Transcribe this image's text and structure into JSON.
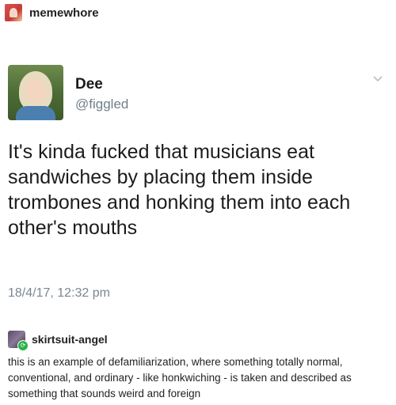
{
  "op": {
    "username": "memewhore",
    "avatar_icon": "user-avatar-icon"
  },
  "tweet": {
    "name": "Dee",
    "handle": "@figgled",
    "text": "It's kinda fucked that musicians eat sandwiches by placing them inside trombones and honking them into each other's mouths",
    "timestamp": "18/4/17, 12:32 pm",
    "menu_icon": "chevron-down-icon"
  },
  "reblog": {
    "username": "skirtsuit-angel",
    "badge_icon": "reblog-badge-icon",
    "badge_color": "#2bb24c",
    "text": "this is an example of defamiliarization, where something totally normal, conventional, and ordinary - like honkwiching - is taken and described as something that sounds weird and foreign"
  }
}
